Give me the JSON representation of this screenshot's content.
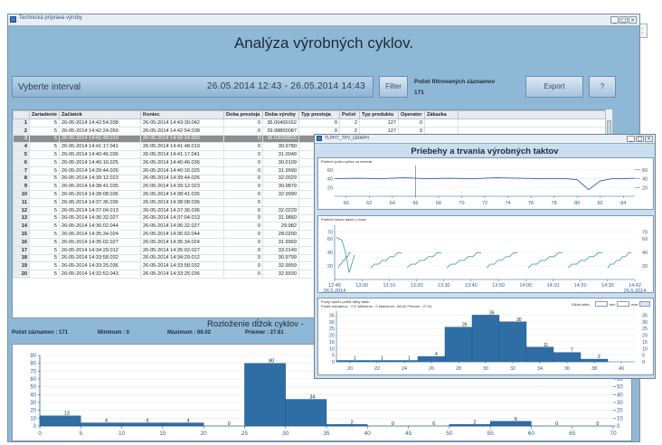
{
  "main_window": {
    "title": "Technická príprava výroby",
    "page_title": "Analýza výrobných cyklov.",
    "interval_label": "Vyberte interval",
    "interval_range": "26.05.2014 12:43 - 26.05.2014 14:43",
    "filter_button": "Filter",
    "count_label": "Počet filtrovaných záznamov",
    "count_value": "171",
    "export_button": "Export",
    "help_button": "?"
  },
  "table": {
    "columns": [
      "",
      "Zariadenie",
      "Začiatok",
      "Koniec",
      "Doba prestoja",
      "Doba výroby",
      "Typ prestoja",
      "Počet",
      "Typ produktu",
      "Operator",
      "Zákazka"
    ],
    "rows": [
      [
        "1",
        "5",
        "26-05-2014 14:42:54.038",
        "26-05-2014 14:43:30.042",
        "0",
        "36.00400162",
        "0",
        "2",
        "127",
        "0",
        ""
      ],
      [
        "2",
        "5",
        "26-05-2014 14:42:24.050",
        "26-05-2014 14:42:54.038",
        "0",
        "29.98800087",
        "0",
        "2",
        "127",
        "0",
        ""
      ],
      [
        "3",
        "5",
        "26-05-2014 14:41:48.019",
        "26-05-2014 14:42:24.050",
        "0",
        "36.03099823",
        "0",
        "2",
        "127",
        "0",
        ""
      ],
      [
        "4",
        "5",
        "26-05-2014 14:41:17.041",
        "26-05-2014 14:41:48.019",
        "0",
        "30.9780",
        "",
        "",
        "",
        "",
        ""
      ],
      [
        "5",
        "5",
        "26-05-2014 14:40:46.036",
        "26-05-2014 14:41:17.041",
        "0",
        "31.0049",
        "",
        "",
        "",
        "",
        ""
      ],
      [
        "6",
        "5",
        "26-05-2014 14:40:16.025",
        "26-05-2014 14:40:46.036",
        "0",
        "30.0109",
        "",
        "",
        "",
        "",
        ""
      ],
      [
        "7",
        "5",
        "26-05-2014 14:39:44.026",
        "26-05-2014 14:40:16.025",
        "0",
        "31.9990",
        "",
        "",
        "",
        "",
        ""
      ],
      [
        "8",
        "5",
        "26-05-2014 14:39:12.023",
        "26-05-2014 14:39:44.026",
        "0",
        "32.0029",
        "",
        "",
        "",
        "",
        ""
      ],
      [
        "9",
        "5",
        "26-05-2014 14:38:41.035",
        "26-05-2014 14:39:12.023",
        "0",
        "30.9879",
        "",
        "",
        "",
        "",
        ""
      ],
      [
        "10",
        "5",
        "26-05-2014 14:38:08.036",
        "26-05-2014 14:38:41.035",
        "0",
        "32.9990",
        "",
        "",
        "",
        "",
        ""
      ],
      [
        "11",
        "5",
        "26-05-2014 14:37:36.036",
        "26-05-2014 14:38:08.036",
        "0",
        "",
        "",
        "",
        "",
        "",
        ""
      ],
      [
        "12",
        "5",
        "26-05-2014 14:37:04.013",
        "26-05-2014 14:37:36.036",
        "0",
        "32.0229",
        "",
        "",
        "",
        "",
        ""
      ],
      [
        "13",
        "5",
        "26-05-2014 14:36:32.027",
        "26-05-2014 14:37:04.013",
        "0",
        "31.9860",
        "",
        "",
        "",
        "",
        ""
      ],
      [
        "14",
        "5",
        "26-05-2014 14:36:02.044",
        "26-05-2014 14:36:32.027",
        "0",
        "29.982",
        "",
        "",
        "",
        "",
        ""
      ],
      [
        "15",
        "5",
        "26-05-2014 14:35:34.024",
        "26-05-2014 14:36:02.044",
        "0",
        "28.0200",
        "",
        "",
        "",
        "",
        ""
      ],
      [
        "16",
        "5",
        "26-05-2014 14:35:02.027",
        "26-05-2014 14:35:34.024",
        "0",
        "31.9969",
        "",
        "",
        "",
        "",
        ""
      ],
      [
        "17",
        "5",
        "26-05-2014 14:34:29.012",
        "26-05-2014 14:35:02.027",
        "0",
        "33.0149",
        "",
        "",
        "",
        "",
        ""
      ],
      [
        "18",
        "5",
        "26-05-2014 14:33:58.032",
        "26-05-2014 14:34:29.012",
        "0",
        "30.9799",
        "",
        "",
        "",
        "",
        ""
      ],
      [
        "19",
        "5",
        "26-05-2014 14:33:25.036",
        "26-05-2014 14:33:58.032",
        "0",
        "32.9959",
        "",
        "",
        "",
        "",
        ""
      ],
      [
        "20",
        "5",
        "26-05-2014 14:32:52.043",
        "26-05-2014 14:33:25.036",
        "0",
        "32.9930",
        "",
        "",
        "",
        "",
        ""
      ]
    ],
    "selected_row": 2
  },
  "histogram_section": {
    "title": "Rozloženie dĺžok cyklov -",
    "count_stat": "Počet záznamov : 171",
    "min_stat": "Minimum : 0",
    "max_stat": "Maximum : 66.02",
    "avg_stat": "Priemer : 27.61"
  },
  "graph_window": {
    "title": "TLPHT_TPV_GRAPH",
    "heading": "Priebehy a trvania výrobných taktov",
    "panel1_caption": "Priebeh počtu cyklov za interval",
    "panel2_caption": "Priebeh časov taktov v čase",
    "panel3_caption": "Počty cyklov podľa dĺžky taktu",
    "panel3_stats": "Počet záznamov : 171    Minimum : 0    Maximum : 66.02    Priemer : 27.61",
    "panel3_filter_label": "Dĺžka taktu",
    "panel3_filter_min": "min",
    "panel3_filter_max": "max"
  },
  "chart_data": [
    {
      "type": "bar",
      "name": "main-histogram",
      "title": "Rozloženie dĺžok cyklov",
      "x_bins": [
        0,
        5,
        10,
        15,
        20,
        25,
        30,
        35,
        40,
        45,
        50,
        55,
        60,
        65,
        70
      ],
      "values": [
        13,
        4,
        4,
        4,
        0,
        80,
        34,
        2,
        0,
        0,
        2,
        6,
        0,
        0
      ],
      "xlim": [
        0,
        70
      ],
      "ylim": [
        0,
        90
      ],
      "x_ticks": [
        0,
        5,
        10,
        15,
        20,
        25,
        30,
        35,
        40,
        45,
        50,
        55,
        60,
        65,
        70
      ],
      "y_ticks": [
        0,
        10,
        20,
        30,
        40,
        50,
        60,
        70,
        80,
        90
      ],
      "bar_color": "#2f6ea5"
    },
    {
      "type": "line",
      "name": "graph-panel1",
      "x_ticks": [
        60,
        62,
        64,
        66,
        68,
        70,
        72,
        74,
        76,
        78,
        80,
        82,
        84
      ],
      "y_ticks": [
        20,
        40,
        60
      ],
      "ylim": [
        0,
        70
      ],
      "x": [
        59,
        61,
        63,
        65,
        67,
        69,
        71,
        73,
        75,
        77,
        79,
        80,
        81,
        82,
        83,
        84,
        85
      ],
      "y": [
        40,
        41,
        40,
        42,
        40,
        41,
        40,
        42,
        41,
        40,
        40,
        38,
        15,
        35,
        40,
        40,
        41
      ],
      "line_color": "#3a55b8"
    },
    {
      "type": "line",
      "name": "graph-panel2",
      "x_tick_labels": [
        "12:45\n26.5.2014",
        "13:00",
        "13:10",
        "13:20",
        "13:30",
        "13:40",
        "13:50",
        "14:00",
        "14:10",
        "14:20",
        "14:30",
        "14:42\n26.5.2014"
      ],
      "y_ticks": [
        20,
        40,
        60,
        70
      ],
      "ylim": [
        0,
        80
      ],
      "line_color": "#2a8aa8"
    },
    {
      "type": "bar",
      "name": "graph-panel3",
      "x_ticks": [
        20,
        22,
        24,
        26,
        28,
        30,
        32,
        34,
        36,
        38,
        40
      ],
      "y_ticks": [
        0,
        5,
        10,
        15,
        20,
        25,
        30,
        35
      ],
      "x_bins": [
        19,
        21,
        23,
        25,
        27,
        29,
        31,
        33,
        35,
        37,
        39
      ],
      "values": [
        1,
        1,
        1,
        4,
        26,
        35,
        30,
        11,
        7,
        2
      ],
      "xlim": [
        20,
        40
      ],
      "ylim": [
        0,
        38
      ],
      "bar_color": "#2f6ea5"
    }
  ]
}
